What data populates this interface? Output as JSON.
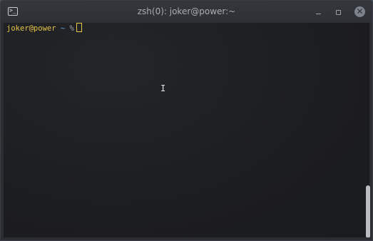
{
  "window": {
    "title": "zsh(0): joker@power:~",
    "app_icon_text": ">_",
    "close_glyph": "✕"
  },
  "terminal": {
    "prompt_user_host": "joker@power",
    "prompt_dir": "~",
    "prompt_symbol": "%"
  },
  "mouse": {
    "ibeam_glyph": "I"
  },
  "colors": {
    "prompt_user": "#e7c547",
    "prompt_dir": "#63a2d8",
    "terminal_bg": "#1c1d20",
    "titlebar_bg": "#2e3035",
    "scrollbar_thumb": "#b9bcc1"
  }
}
